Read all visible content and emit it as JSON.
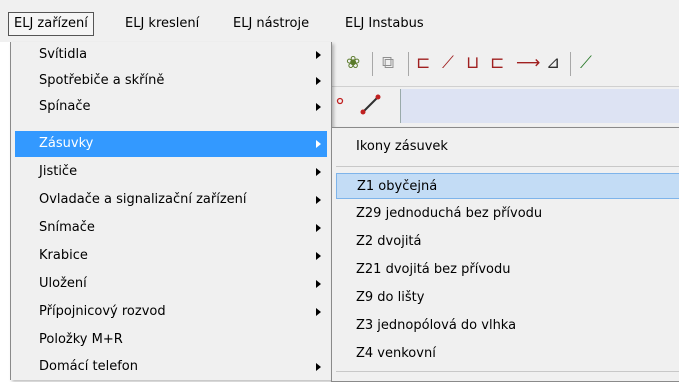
{
  "menubar": {
    "items": [
      {
        "label": "ELJ zařízení",
        "active": true
      },
      {
        "label": "ELJ kreslení",
        "active": false
      },
      {
        "label": "ELJ nástroje",
        "active": false
      },
      {
        "label": "ELJ Instabus",
        "active": false
      }
    ]
  },
  "toolbar": {
    "glyphs": [
      "❀",
      "⧉",
      "⊏",
      "⟋",
      "⊔",
      "⊏",
      "⟶",
      "⊿",
      "⟋"
    ]
  },
  "menu": {
    "items": [
      {
        "label": "Svítidla",
        "submenu": true
      },
      {
        "label": "Spotřebiče a skříně",
        "submenu": true
      },
      {
        "label": "Spínače",
        "submenu": true
      },
      {
        "label": "Zásuvky",
        "submenu": true,
        "selected": true
      },
      {
        "label": "Jističe",
        "submenu": true
      },
      {
        "label": "Ovladače a signalizační zařízení",
        "submenu": true
      },
      {
        "label": "Snímače",
        "submenu": true
      },
      {
        "label": "Krabice",
        "submenu": true
      },
      {
        "label": "Uložení",
        "submenu": true
      },
      {
        "label": "Přípojnicový rozvod",
        "submenu": true
      },
      {
        "label": "Položky M+R",
        "submenu": false
      },
      {
        "label": "Domácí telefon",
        "submenu": true
      }
    ]
  },
  "submenu": {
    "header": "Ikony zásuvek",
    "items": [
      {
        "label": "Z1  obyčejná",
        "highlighted": true
      },
      {
        "label": "Z29 jednoduchá bez přívodu"
      },
      {
        "label": "Z2  dvojitá"
      },
      {
        "label": "Z21 dvojitá bez přívodu"
      },
      {
        "label": "Z9  do lišty"
      },
      {
        "label": "Z3  jednopólová do vlhka"
      },
      {
        "label": "Z4  venkovní"
      }
    ]
  },
  "colors": {
    "selection": "#3399ff",
    "highlight": "#c3dcf5",
    "menu_bg": "#f0f0f0"
  }
}
